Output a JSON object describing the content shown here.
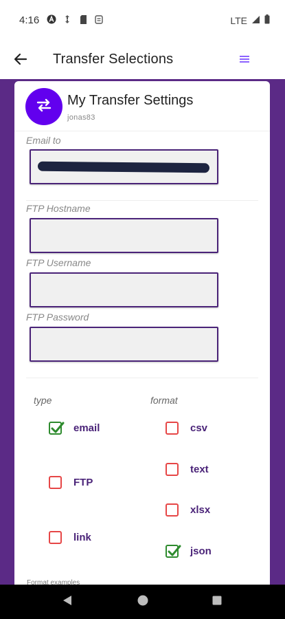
{
  "status_bar": {
    "time": "4:16",
    "network": "LTE",
    "icons": [
      "a-circle-icon",
      "data-saver-icon",
      "sd-card-icon",
      "sync-icon",
      "signal-icon",
      "battery-icon"
    ]
  },
  "app_bar": {
    "title": "Transfer Selections",
    "back_icon": "arrow-left-icon",
    "menu_icon": "hamburger-icon",
    "accent": "#7c4dff"
  },
  "card": {
    "title": "My Transfer Settings",
    "subtitle": "jonas83",
    "avatar_icon": "swap-arrows-icon",
    "avatar_color": "#6200ee"
  },
  "fields": {
    "email": {
      "label": "Email to",
      "value": ""
    },
    "ftp_hostname": {
      "label": "FTP Hostname",
      "value": ""
    },
    "ftp_username": {
      "label": "FTP Username",
      "value": ""
    },
    "ftp_password": {
      "label": "FTP Password",
      "value": ""
    }
  },
  "type": {
    "label": "type",
    "options": [
      {
        "label": "email",
        "checked": true
      },
      {
        "label": "FTP",
        "checked": false
      },
      {
        "label": "link",
        "checked": false
      }
    ]
  },
  "format": {
    "label": "format",
    "options": [
      {
        "label": "csv",
        "checked": false
      },
      {
        "label": "text",
        "checked": false
      },
      {
        "label": "xlsx",
        "checked": false
      },
      {
        "label": "json",
        "checked": true
      }
    ]
  },
  "footer": {
    "hint": "Format examples"
  },
  "colors": {
    "purple_bg": "#5b2a86",
    "input_border": "#4a2378",
    "checked": "#2e8b2e",
    "unchecked": "#e64646"
  }
}
